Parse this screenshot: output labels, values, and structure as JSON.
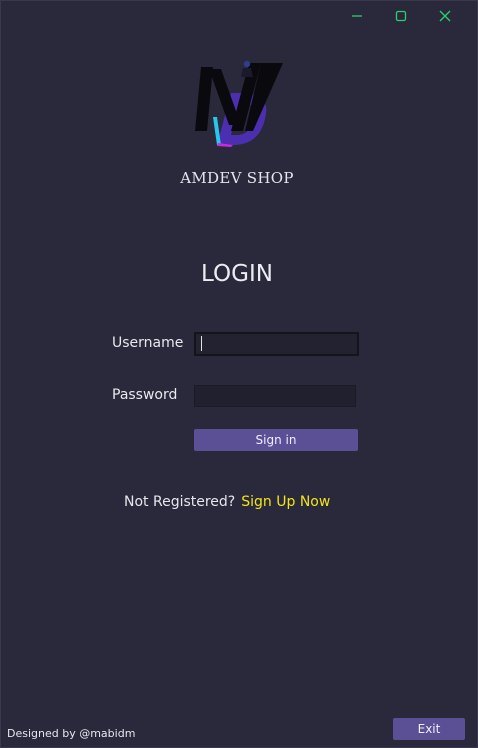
{
  "window": {
    "controls": [
      "minimize-icon",
      "maximize-icon",
      "close-icon"
    ],
    "control_color": "#2ecc71"
  },
  "brand": {
    "name": "AMDEV SHOP"
  },
  "login": {
    "title": "LOGIN",
    "username_label": "Username",
    "username_value": "",
    "password_label": "Password",
    "password_value": "",
    "signin_label": "Sign in"
  },
  "register": {
    "prompt": "Not Registered?",
    "link": "Sign Up Now",
    "link_color": "#f1e51a"
  },
  "footer": {
    "credit": "Designed by @mabidm",
    "exit_label": "Exit"
  },
  "colors": {
    "background": "#2a293b",
    "accent": "#5b4f96"
  }
}
